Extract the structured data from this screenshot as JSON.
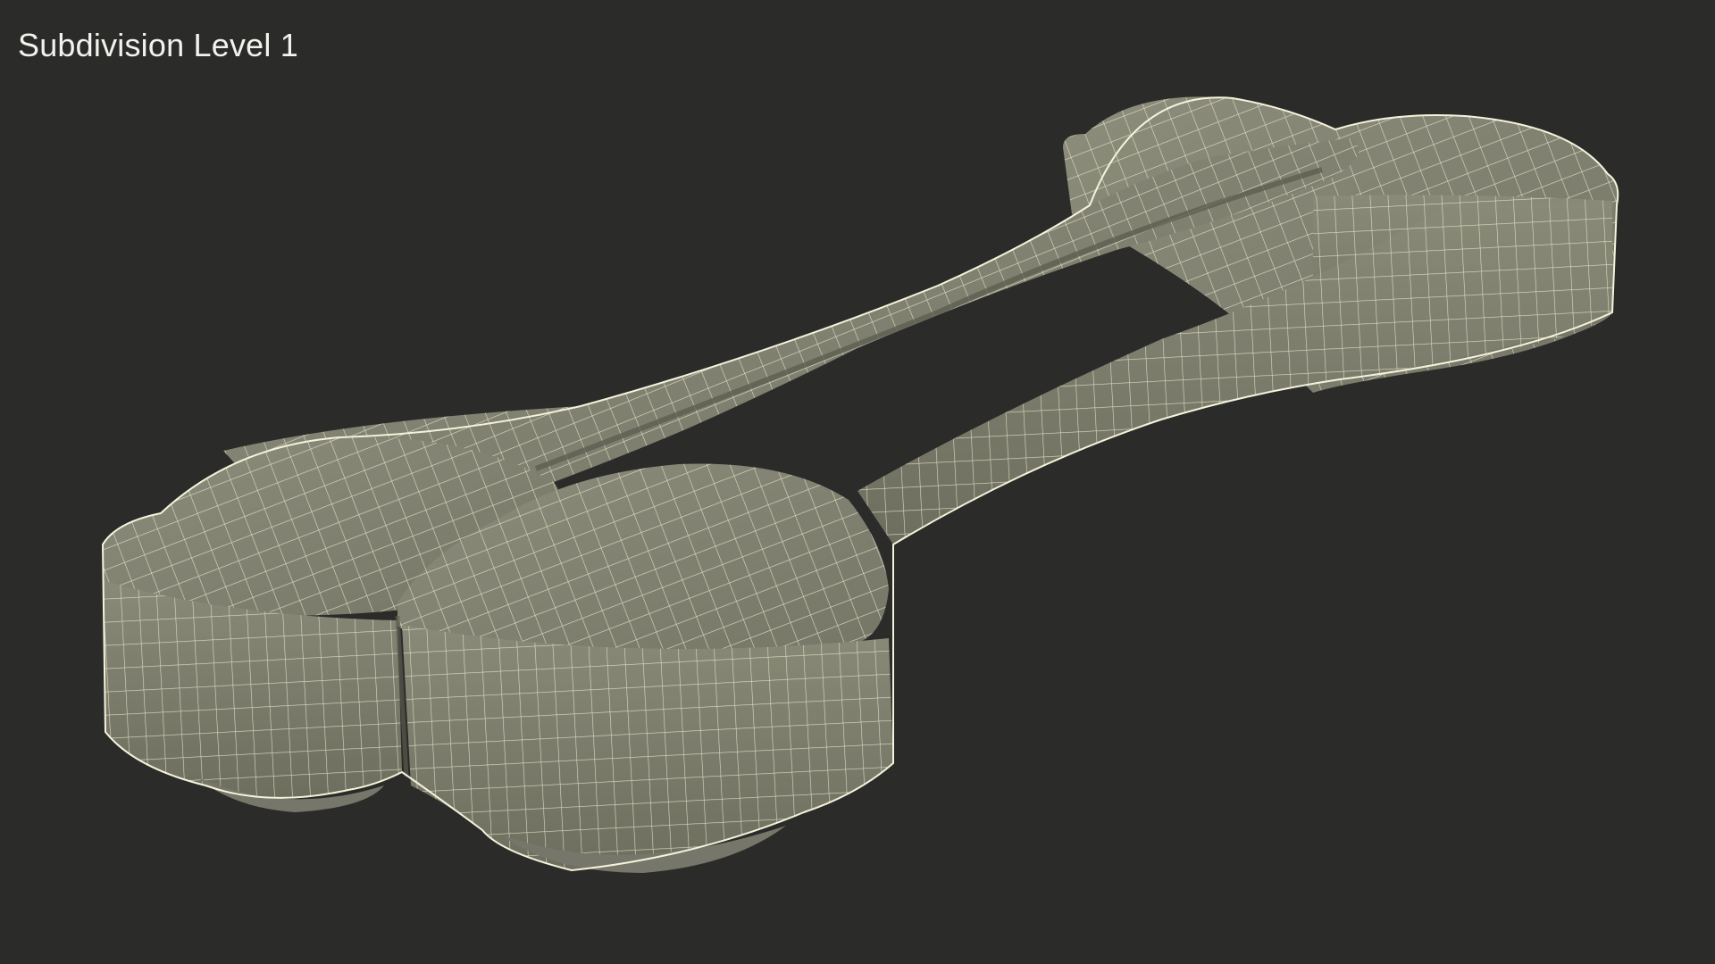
{
  "viewport": {
    "label": "Subdivision Level 1",
    "background_color": "#2b2b29"
  },
  "model": {
    "subject": "dog bone",
    "display_mode": "wireframe on shaded",
    "surface_color": "#80806f",
    "wire_color": "#f4f3dc"
  }
}
